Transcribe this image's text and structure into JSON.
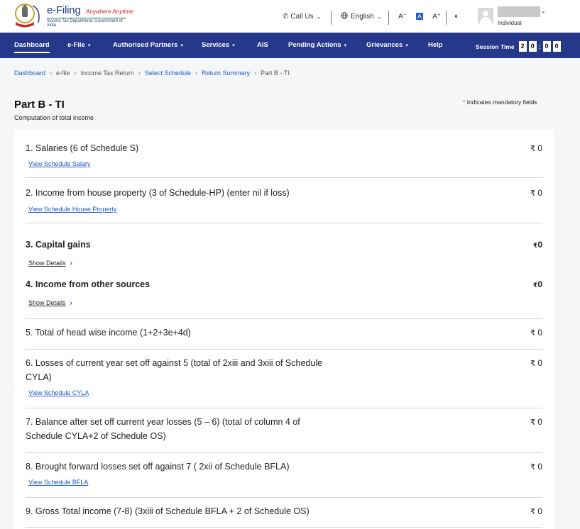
{
  "header": {
    "logo_title": "e-Filing",
    "logo_tagline": "Anywhere Anytime",
    "logo_subtitle": "Income Tax Department, Government of India",
    "call_us": "Call Us",
    "language": "English",
    "font_decrease": "A⁻",
    "font_default": "A",
    "font_increase": "A⁺",
    "user_type": "Individual"
  },
  "nav": {
    "items": [
      {
        "label": "Dashboard",
        "has_dropdown": false,
        "active": true
      },
      {
        "label": "e-File",
        "has_dropdown": true
      },
      {
        "label": "Authorised Partners",
        "has_dropdown": true
      },
      {
        "label": "Services",
        "has_dropdown": true
      },
      {
        "label": "AIS",
        "has_dropdown": false
      },
      {
        "label": "Pending Actions",
        "has_dropdown": true
      },
      {
        "label": "Grievances",
        "has_dropdown": true
      },
      {
        "label": "Help",
        "has_dropdown": false
      }
    ],
    "session_label": "Session Time",
    "session_digits": [
      "2",
      "0",
      "0",
      "0"
    ]
  },
  "breadcrumb": [
    {
      "label": "Dashboard",
      "link": true
    },
    {
      "label": "e-file",
      "link": false
    },
    {
      "label": "Income Tax Return",
      "link": false
    },
    {
      "label": "Select Schedule",
      "link": true
    },
    {
      "label": "Return Summary",
      "link": true
    },
    {
      "label": "Part B - TI",
      "link": false
    }
  ],
  "page": {
    "title": "Part B - TI",
    "subtitle": "Computation of total income",
    "mandatory_star": "*",
    "mandatory_note": "Indicates mandatory fields"
  },
  "currency_symbol": "₹",
  "rows": [
    {
      "label": "1. Salaries (6 of Schedule S)",
      "amount": "0",
      "link": "View Schedule Salary"
    },
    {
      "label": "2. Income from house property (3 of Schedule-HP) (enter nil if loss)",
      "amount": "0",
      "link": "View Schedule House Property"
    },
    {
      "label": "3. Capital gains",
      "amount": "0",
      "show_details": "Show Details"
    },
    {
      "label": "4. Income from other sources",
      "amount": "0",
      "show_details": "Show Details"
    },
    {
      "label": "5. Total of head wise income (1+2+3e+4d)",
      "amount": "0"
    },
    {
      "label_line1": "6. Losses of current year set off against 5 (total of 2xiii and 3xiii of Schedule",
      "label_line2": "CYLA)",
      "amount": "0",
      "link": "View Schedule CYLA"
    },
    {
      "label_line1": "7. Balance after set off current year losses (5 – 6) (total of column 4 of",
      "label_line2": "Schedule CYLA+2 of Schedule OS)",
      "amount": "0"
    },
    {
      "label": "8. Brought forward losses set off against 7 ( 2xii of Schedule BFLA)",
      "amount": "0",
      "link": "View Schedule BFLA"
    },
    {
      "label": "9. Gross Total income (7-8) (3xiii of Schedule BFLA + 2 of Schedule OS)",
      "amount": "0"
    }
  ]
}
